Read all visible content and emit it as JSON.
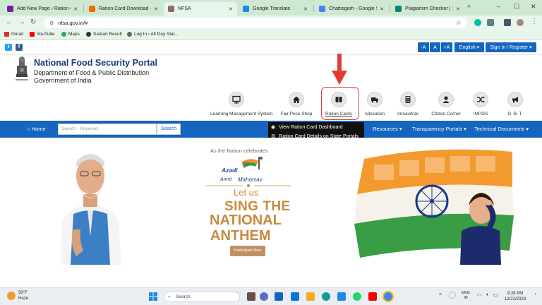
{
  "browser": {
    "tabs": [
      {
        "title": "Add New Page ‹ Ration Ca",
        "fav_color": "#7b1fa2"
      },
      {
        "title": "Ration Card Download - “",
        "fav_color": "#ef6c00"
      },
      {
        "title": "NFSA",
        "fav_color": "#8d6e63"
      },
      {
        "title": "Google Translate",
        "fav_color": "#1e88e5"
      },
      {
        "title": "Chattisgarh - Google Sear",
        "fav_color": "#4285f4"
      },
      {
        "title": "Plagiarism Checker | 100%",
        "fav_color": "#00897b"
      }
    ],
    "url": "nfsa.gov.in/#",
    "bookmarks": [
      "Gmail",
      "YouTube",
      "Maps",
      "Sarkari Result",
      "Log In ‹ All Day Stat..."
    ]
  },
  "site_top": {
    "font_decrease": "-A",
    "font_normal": "A",
    "font_increase": "+A",
    "language": "English ▾",
    "signin": "Sign In / Register ▾"
  },
  "header": {
    "title": "National Food Security Portal",
    "subtitle1": "Department of Food & Public Distribution",
    "subtitle2": "Government of India",
    "emblem_caption": "सत्यमेव जयते"
  },
  "icon_nav": [
    {
      "label": "Learning Management System",
      "icon": "monitor-icon"
    },
    {
      "label": "Fair Price Shop",
      "icon": "shop-icon"
    },
    {
      "label": "Ration Cards",
      "icon": "book-icon"
    },
    {
      "label": "Allocation",
      "icon": "truck-icon"
    },
    {
      "label": "Annavitran",
      "icon": "calculator-icon"
    },
    {
      "label": "Citizen Corner",
      "icon": "user-icon"
    },
    {
      "label": "IMPDS",
      "icon": "shuffle-icon"
    },
    {
      "label": "D. B. T.",
      "icon": "megaphone-icon"
    }
  ],
  "menu": {
    "home": "Home",
    "search_placeholder": "Search - Keyword",
    "search_button": "Search",
    "resources": "Resources ▾",
    "transparency": "Transparency Portals ▾",
    "technical": "Technical Documents ▾"
  },
  "dropdown": [
    "View Ration Card Dashboard",
    "Ration Card Details on State Portals"
  ],
  "banner": {
    "line1": "As the Nation celebrates",
    "azadi": "Azadi",
    "ka": "Ka",
    "amrit": "Amrit",
    "mahotsav": "Mahotsav",
    "letus": "Let us",
    "sing": "SING THE",
    "national": "NATIONAL",
    "anthem": "ANTHEM",
    "participate": "Participate Now"
  },
  "taskbar": {
    "temperature": "50°F",
    "weather": "Haze",
    "search": "Search",
    "lang1": "ENG",
    "lang2": "IN",
    "time": "9:28 PM",
    "date": "12/21/2023"
  },
  "colors": {
    "menu_blue": "#1565c0",
    "title_blue": "#1a3a7a",
    "banner_gold": "#c98a3c",
    "highlight_red": "#e53935"
  }
}
